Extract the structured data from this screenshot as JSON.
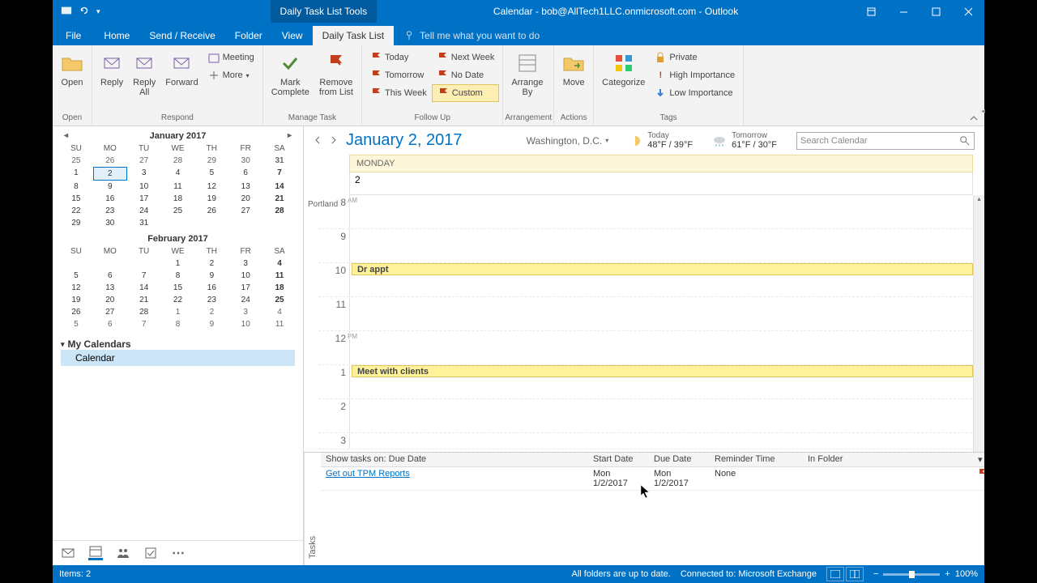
{
  "titlebar": {
    "tools_label": "Daily Task List Tools",
    "title": "Calendar - bob@AllTech1LLC.onmicrosoft.com - Outlook"
  },
  "tabs": {
    "file": "File",
    "home": "Home",
    "send_receive": "Send / Receive",
    "folder": "Folder",
    "view": "View",
    "daily_task_list": "Daily Task List",
    "tell_me": "Tell me what you want to do"
  },
  "ribbon": {
    "open": {
      "open": "Open",
      "group": "Open"
    },
    "respond": {
      "reply": "Reply",
      "reply_all": "Reply\nAll",
      "forward": "Forward",
      "meeting": "Meeting",
      "more": "More",
      "group": "Respond"
    },
    "manage": {
      "mark_complete": "Mark\nComplete",
      "remove": "Remove\nfrom List",
      "group": "Manage Task"
    },
    "followup": {
      "today": "Today",
      "tomorrow": "Tomorrow",
      "this_week": "This Week",
      "next_week": "Next Week",
      "no_date": "No Date",
      "custom": "Custom",
      "group": "Follow Up"
    },
    "arrangement": {
      "arrange_by": "Arrange\nBy",
      "group": "Arrangement"
    },
    "actions": {
      "move": "Move",
      "group": "Actions"
    },
    "categorize": "Categorize",
    "tags": {
      "private": "Private",
      "high": "High Importance",
      "low": "Low Importance",
      "group": "Tags"
    }
  },
  "datenav": {
    "month1": "January 2017",
    "month2": "February 2017",
    "days": [
      "SU",
      "MO",
      "TU",
      "WE",
      "TH",
      "FR",
      "SA"
    ]
  },
  "sidebar": {
    "my_calendars": "My Calendars",
    "calendar": "Calendar"
  },
  "calendar_header": {
    "date": "January 2, 2017",
    "location": "Washington, D.C.",
    "today_label": "Today",
    "today_temp": "48°F / 39°F",
    "tomorrow_label": "Tomorrow",
    "tomorrow_temp": "61°F / 30°F",
    "search_placeholder": "Search Calendar"
  },
  "day": {
    "weekday": "MONDAY",
    "daynum": "2",
    "portland": "Portland"
  },
  "appointments": {
    "dr": "Dr appt",
    "meet": "Meet with clients"
  },
  "hours": {
    "h8": "8",
    "am": "AM",
    "h9": "9",
    "h10": "10",
    "h11": "11",
    "h12": "12",
    "pm": "PM",
    "h1": "1",
    "h2": "2",
    "h3": "3"
  },
  "tasks": {
    "label": "Tasks",
    "filter": "Show tasks on: Due Date",
    "col_start": "Start Date",
    "col_due": "Due Date",
    "col_reminder": "Reminder Time",
    "col_folder": "In Folder",
    "row1": {
      "subject": "Get out TPM Reports",
      "start": "Mon 1/2/2017",
      "due": "Mon 1/2/2017",
      "reminder": "None",
      "folder": ""
    }
  },
  "status": {
    "items": "Items: 2",
    "sync": "All folders are up to date.",
    "connected": "Connected to: Microsoft Exchange",
    "zoom": "100%"
  }
}
